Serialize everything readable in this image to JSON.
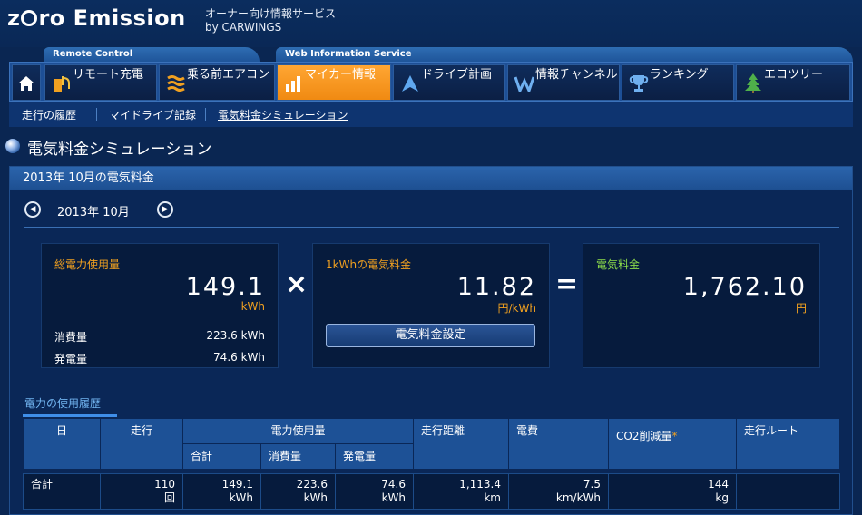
{
  "header": {
    "logo_prefix": "z",
    "logo_rest": "ro Emission",
    "service_line1": "オーナー向け情報サービス",
    "service_line2": "by CARWINGS"
  },
  "groups": {
    "remote": "Remote Control",
    "web": "Web Information Service"
  },
  "nav": {
    "home_icon": "home-icon",
    "items": [
      {
        "label": "リモート充電",
        "icon": "charger-icon",
        "active": false
      },
      {
        "label": "乗る前エアコン",
        "icon": "aircon-icon",
        "active": false
      },
      {
        "label": "マイカー情報",
        "icon": "bar-chart-icon",
        "active": true
      },
      {
        "label": "ドライブ計画",
        "icon": "navigation-arrow-icon",
        "active": false
      },
      {
        "label": "情報チャンネル",
        "icon": "channel-w-icon",
        "active": false
      },
      {
        "label": "ランキング",
        "icon": "trophy-icon",
        "active": false
      },
      {
        "label": "エコツリー",
        "icon": "tree-icon",
        "active": false
      }
    ]
  },
  "subnav": {
    "items": [
      "走行の履歴",
      "マイドライブ記録",
      "電気料金シミュレーション"
    ],
    "current_index": 2
  },
  "page": {
    "title": "電気料金シミュレーション"
  },
  "panel": {
    "heading": "2013年 10月の電気料金",
    "month_label": "2013年 10月",
    "prev_icon": "chevron-left-icon",
    "next_icon": "chevron-right-icon"
  },
  "usage": {
    "title": "総電力使用量",
    "value": "149.1",
    "unit": "kWh",
    "consumption_label": "消費量",
    "consumption_value": "223.6 kWh",
    "generation_label": "発電量",
    "generation_value": "74.6 kWh"
  },
  "rate": {
    "title": "1kWhの電気料金",
    "value": "11.82",
    "unit": "円/kWh",
    "button_label": "電気料金設定"
  },
  "cost": {
    "title": "電気料金",
    "value": "1,762.10",
    "unit": "円"
  },
  "operators": {
    "times": "×",
    "equals": "="
  },
  "history": {
    "tab_label": "電力の使用履歴",
    "headers": {
      "day": "日",
      "trips": "走行",
      "power": "電力使用量",
      "power_total": "合計",
      "power_consumption": "消費量",
      "power_generation": "発電量",
      "distance": "走行距離",
      "efficiency": "電費",
      "co2": "CO2削減量",
      "co2_mark": "*",
      "route": "走行ルート"
    },
    "total_row": {
      "label": "合計",
      "trips": "110",
      "trips_unit": "回",
      "total": "149.1",
      "total_unit": "kWh",
      "consumption": "223.6",
      "consumption_unit": "kWh",
      "generation": "74.6",
      "generation_unit": "kWh",
      "distance": "1,113.4",
      "distance_unit": "km",
      "efficiency": "7.5",
      "efficiency_unit": "km/kWh",
      "co2": "144",
      "co2_unit": "kg",
      "route": ""
    }
  },
  "colors": {
    "background": "#0a2652",
    "active_tab": "#f08a12",
    "accent_orange": "#f0a020",
    "accent_green": "#8ddd4a",
    "table_header": "#1d5196"
  }
}
